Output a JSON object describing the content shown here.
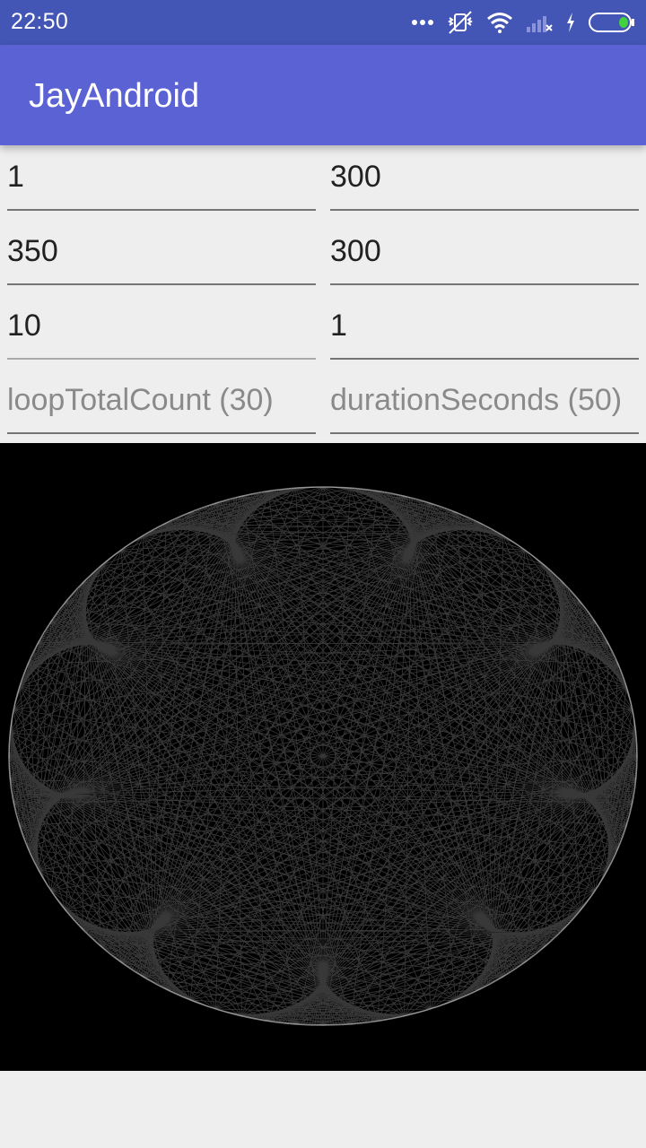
{
  "status_bar": {
    "time": "22:50",
    "icons": [
      "more-dots-icon",
      "vibrate-off-icon",
      "wifi-icon",
      "signal-icon",
      "charging-icon",
      "battery-icon"
    ],
    "battery_accent": "#43d23c"
  },
  "app_bar": {
    "title": "JayAndroid",
    "color": "#5b62d4"
  },
  "fields": [
    {
      "value": "1"
    },
    {
      "value": "300"
    },
    {
      "value": "350"
    },
    {
      "value": "300"
    },
    {
      "value": "10"
    },
    {
      "value": "1"
    },
    {
      "placeholder": "loopTotalCount (30)"
    },
    {
      "placeholder": "durationSeconds (50)"
    }
  ],
  "drawing": {
    "background": "#000000",
    "line_color": "#ffffff"
  }
}
